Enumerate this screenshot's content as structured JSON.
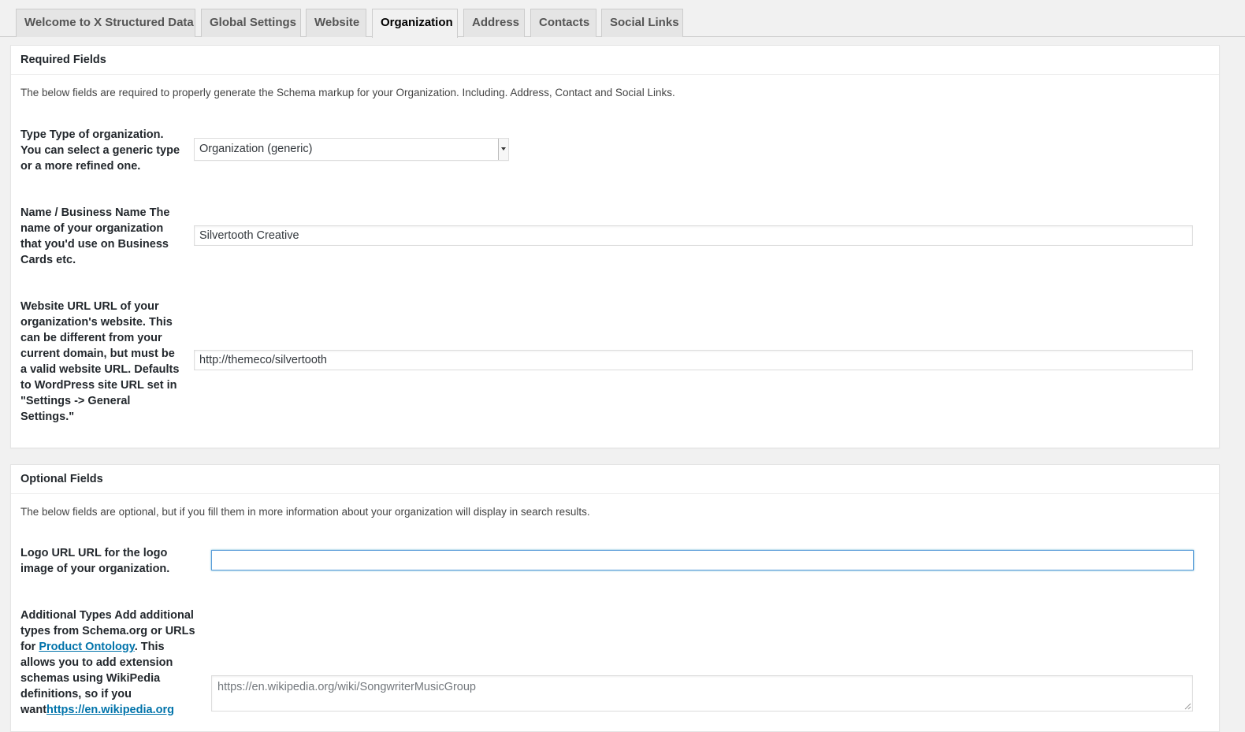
{
  "tabs": [
    {
      "label": "Welcome to X Structured Data"
    },
    {
      "label": "Global Settings"
    },
    {
      "label": "Website"
    },
    {
      "label": "Organization",
      "active": true
    },
    {
      "label": "Address"
    },
    {
      "label": "Contacts"
    },
    {
      "label": "Social Links"
    }
  ],
  "required": {
    "heading": "Required Fields",
    "description": "The below fields are required to properly generate the Schema markup for your Organization. Including. Address, Contact and Social Links.",
    "type_label": "Type Type of organization. You can select a generic type or a more refined one.",
    "type_value": "Organization (generic)",
    "name_label": "Name / Business Name The name of your organization that you'd use on Business Cards etc.",
    "name_value": "Silvertooth Creative",
    "url_label": "Website URL URL of your organization's website. This can be different from your current domain, but must be a valid website URL. Defaults to WordPress site URL set in \"Settings -> General Settings.\"",
    "url_value": "http://themeco/silvertooth"
  },
  "optional": {
    "heading": "Optional Fields",
    "description": "The below fields are optional, but if you fill them in more information about your organization will display in search results.",
    "logo_label": "Logo URL URL for the logo image of your organization.",
    "logo_value": "",
    "types_label_part1": "Additional Types Add additional types from Schema.org or URLs for ",
    "types_link": "Product Ontology",
    "types_label_part2": ". This allows you to add extension schemas using WikiPedia definitions, so if you want",
    "types_link2": "https://en.wikipedia.org",
    "types_placeholder": "https://en.wikipedia.org/wiki/SongwriterMusicGroup"
  },
  "colors": {
    "accent": "#0073aa",
    "focus": "#5b9dd9",
    "background": "#f1f1f1"
  }
}
